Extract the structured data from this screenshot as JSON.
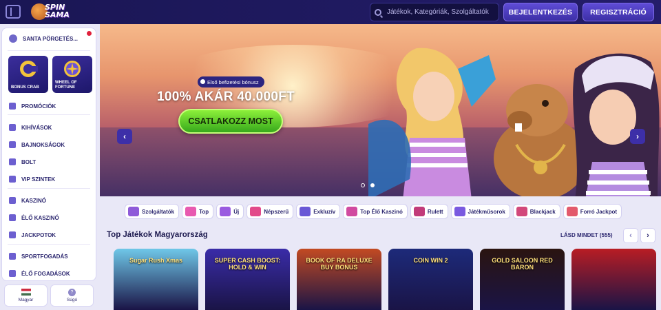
{
  "header": {
    "logo_text": [
      "SPIN",
      "SAMA"
    ],
    "search_placeholder": "Játékok, Kategóriák, Szolgáltatók",
    "login_label": "BEJELENTKEZÉS",
    "register_label": "REGISZTRÁCIÓ"
  },
  "sidebar": {
    "santa_label": "SANTA PÖRGETÉS...",
    "tiles": [
      {
        "label": "BONUS CRAB",
        "icon": "crab-claw-icon"
      },
      {
        "label": "WHEEL OF FORTUNE",
        "icon": "wheel-icon"
      }
    ],
    "items": [
      {
        "label": "PROMÓCIÓK",
        "icon": "gift-icon"
      },
      {
        "label": "KIHÍVÁSOK",
        "icon": "target-icon"
      },
      {
        "label": "BAJNOKSÁGOK",
        "icon": "trophy-icon"
      },
      {
        "label": "BOLT",
        "icon": "shop-icon"
      },
      {
        "label": "VIP SZINTEK",
        "icon": "vip-icon"
      },
      {
        "label": "KASZINÓ",
        "icon": "slot-icon"
      },
      {
        "label": "ÉLŐ KASZINÓ",
        "icon": "live-casino-icon"
      },
      {
        "label": "JACKPOTOK",
        "icon": "jackpot-icon"
      },
      {
        "label": "SPORTFOGADÁS",
        "icon": "sport-icon"
      },
      {
        "label": "ÉLŐ FOGADÁSOK",
        "icon": "live-bet-icon"
      }
    ],
    "language_label": "Magyar",
    "help_label": "Súgó"
  },
  "hero": {
    "badge": "Első befizetési bónusz",
    "title": "100% AKÁR 40.000FT",
    "cta_label": "CSATLAKOZZ MOST",
    "prev_label": "‹",
    "next_label": "›"
  },
  "categories": [
    {
      "label": "Szolgáltatók",
      "color": "#8f5bd9"
    },
    {
      "label": "Top",
      "color": "#e85ab0"
    },
    {
      "label": "Új",
      "color": "#9a5be0"
    },
    {
      "label": "Népszerű",
      "color": "#e24a8a"
    },
    {
      "label": "Exkluzív",
      "color": "#6a58d6"
    },
    {
      "label": "Top Élő Kaszinó",
      "color": "#d14aa0"
    },
    {
      "label": "Rulett",
      "color": "#c23b7a"
    },
    {
      "label": "Játékműsorok",
      "color": "#7a5ae0"
    },
    {
      "label": "Blackjack",
      "color": "#d2487a"
    },
    {
      "label": "Forró Jackpot",
      "color": "#e35a6c"
    }
  ],
  "top_games": {
    "title": "Top Játékok Magyarország",
    "see_all": "LÁSD MINDET (555)",
    "prev_label": "‹",
    "next_label": "›",
    "games": [
      {
        "title": "Sugar Rush Xmas",
        "color": "#6fc7e8"
      },
      {
        "title": "SUPER CASH BOOST: HOLD & WIN",
        "color": "#3a2ca8"
      },
      {
        "title": "BOOK OF RA DELUXE BUY BONUS",
        "color": "#c24a22"
      },
      {
        "title": "COIN WIN 2",
        "color": "#1d2a7a"
      },
      {
        "title": "GOLD SALOON RED BARON",
        "color": "#2a1410"
      },
      {
        "title": "",
        "color": "#b81d24"
      }
    ]
  }
}
